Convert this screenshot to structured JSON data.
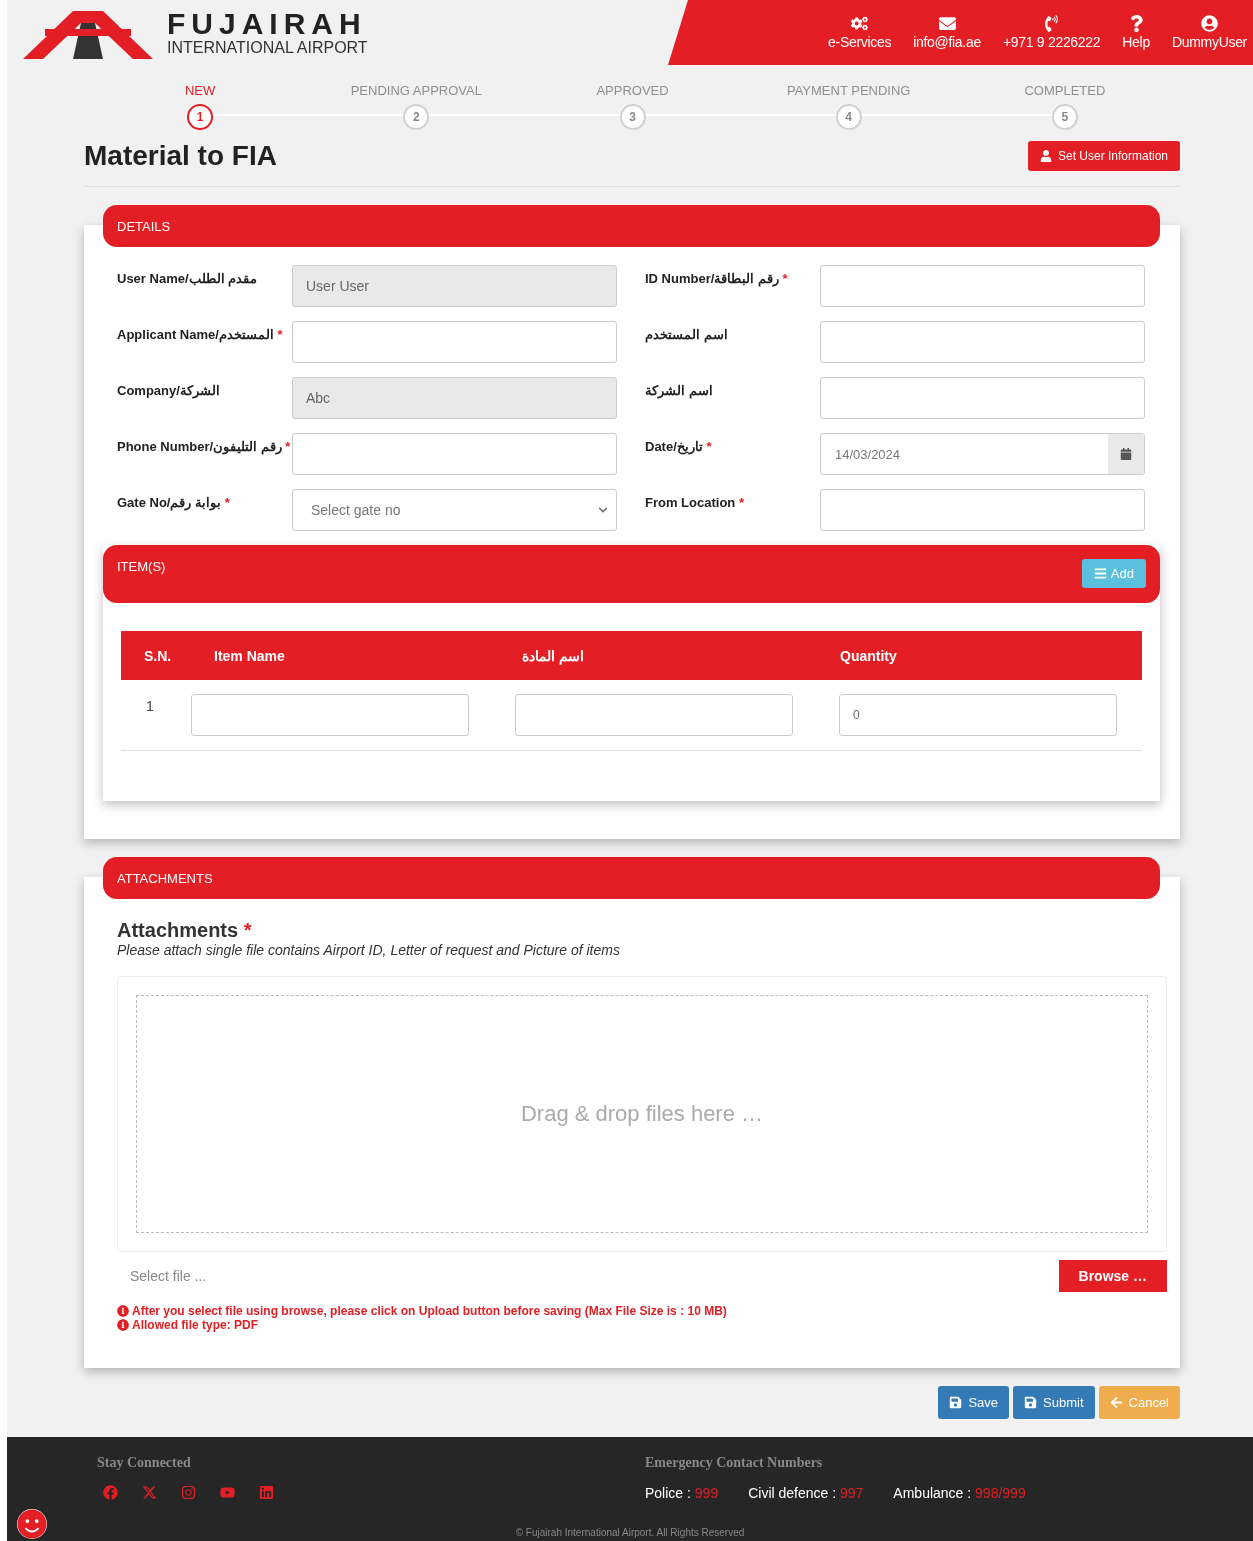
{
  "header": {
    "logo": {
      "name": "FUJAIRAH",
      "subtitle": "INTERNATIONAL AIRPORT"
    },
    "nav": [
      {
        "kind": "services",
        "label": "e-Services"
      },
      {
        "kind": "mail",
        "label": "info@fia.ae"
      },
      {
        "kind": "phone",
        "label": "+971 9 2226222"
      },
      {
        "kind": "help",
        "label": "Help"
      },
      {
        "kind": "user",
        "label": "DummyUser"
      }
    ]
  },
  "steps": [
    {
      "label": "NEW",
      "number": "1",
      "selected": true
    },
    {
      "label": "PENDING APPROVAL",
      "number": "2",
      "selected": false
    },
    {
      "label": "APPROVED",
      "number": "3",
      "selected": false
    },
    {
      "label": "PAYMENT PENDING",
      "number": "4",
      "selected": false
    },
    {
      "label": "COMPLETED",
      "number": "5",
      "selected": false
    }
  ],
  "page_title": "Material to FIA",
  "set_user_button": "Set User Information",
  "details": {
    "title": "DETAILS",
    "rows": [
      {
        "left": {
          "label": "User Name/مقدم الطلب",
          "kind": "readonly",
          "value": "User User"
        },
        "right": {
          "label": "ID Number/رقم البطاقة",
          "required_mark": "*",
          "kind": "text"
        }
      },
      {
        "left": {
          "label": "Applicant Name/المستخدم",
          "required_mark": "*",
          "kind": "text"
        },
        "right": {
          "label": "اسم المستخدم",
          "kind": "text"
        }
      },
      {
        "left": {
          "label": "Company/الشركة",
          "kind": "readonly",
          "value": "Abc"
        },
        "right": {
          "label": "اسم الشركة",
          "kind": "text"
        }
      },
      {
        "left": {
          "label": "Phone Number/رقم التليفون",
          "required_mark": "*",
          "kind": "text"
        },
        "right": {
          "label": "Date/تاريخ",
          "required_mark": "*",
          "kind": "date",
          "value": "14/03/2024"
        }
      },
      {
        "left": {
          "label": "Gate No/بوابة رقم",
          "required_mark": "*",
          "kind": "select",
          "placeholder": "Select gate no"
        },
        "right": {
          "label": "From Location",
          "required_mark": "*",
          "kind": "text"
        }
      }
    ]
  },
  "items": {
    "title": "ITEM(S)",
    "add_button": "Add",
    "columns": [
      "S.N.",
      "Item Name",
      "اسم المادة",
      "Quantity"
    ],
    "rows": [
      {
        "sn": "1",
        "item_name": "",
        "arabic_name": "",
        "quantity": "0"
      }
    ]
  },
  "attachments": {
    "title": "ATTACHMENTS",
    "heading": "Attachments",
    "required_mark": "*",
    "hint": "Please attach single file contains Airport ID, Letter of request and Picture of items",
    "dropzone": "Drag & drop files here …",
    "file_placeholder": "Select file ...",
    "browse_button": "Browse …",
    "notes": [
      "After you select file using browse, please click on Upload button before saving (Max File Size is : 10 MB)",
      "Allowed file type: PDF"
    ]
  },
  "actions": [
    {
      "kind": "save",
      "label": "Save"
    },
    {
      "kind": "submit",
      "label": "Submit"
    },
    {
      "kind": "cancel",
      "label": "Cancel"
    }
  ],
  "footer": {
    "stay_connected": "Stay Connected",
    "social": [
      {
        "kind": "facebook"
      },
      {
        "kind": "x"
      },
      {
        "kind": "instagram"
      },
      {
        "kind": "youtube"
      },
      {
        "kind": "linkedin"
      }
    ],
    "emergency_title": "Emergency Contact Numbers",
    "contacts": [
      {
        "label": "Police :",
        "number": "999"
      },
      {
        "label": "Civil defence :",
        "number": "997"
      },
      {
        "label": "Ambulance :",
        "number": "998/999"
      }
    ],
    "copyright": "© Fujairah International Airport. All Rights Reserved"
  }
}
